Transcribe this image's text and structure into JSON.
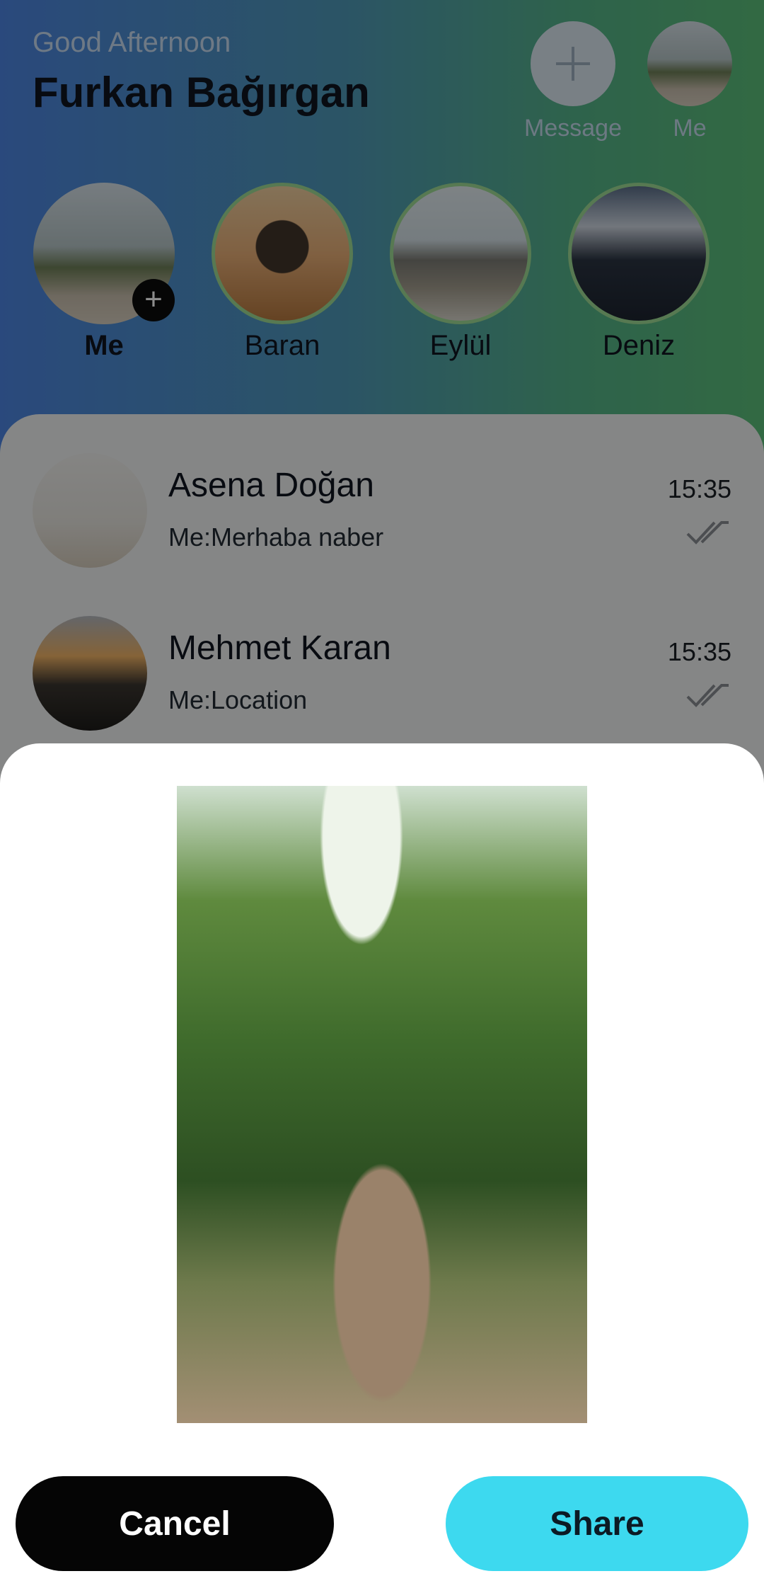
{
  "header": {
    "greeting": "Good Afternoon",
    "username": "Furkan Bağırgan",
    "actions": [
      {
        "label": "Message",
        "icon": "plus-icon"
      },
      {
        "label": "Me",
        "icon": "profile-photo"
      }
    ]
  },
  "stories": [
    {
      "name": "Me",
      "add_icon": "+"
    },
    {
      "name": "Baran"
    },
    {
      "name": "Eylül"
    },
    {
      "name": "Deniz"
    }
  ],
  "chats": [
    {
      "name": "Asena Doğan",
      "preview": "Me:Merhaba naber",
      "time": "15:35",
      "status_icon": "double-check-icon"
    },
    {
      "name": "Mehmet Karan",
      "preview": "Me:Location",
      "time": "15:35",
      "status_icon": "double-check-icon"
    }
  ],
  "share_sheet": {
    "image": "forest-path-photo",
    "cancel_label": "Cancel",
    "share_label": "Share"
  },
  "colors": {
    "share_button": "#3dd9ef",
    "cancel_button": "#050505",
    "story_ring": "#9fdd95"
  }
}
